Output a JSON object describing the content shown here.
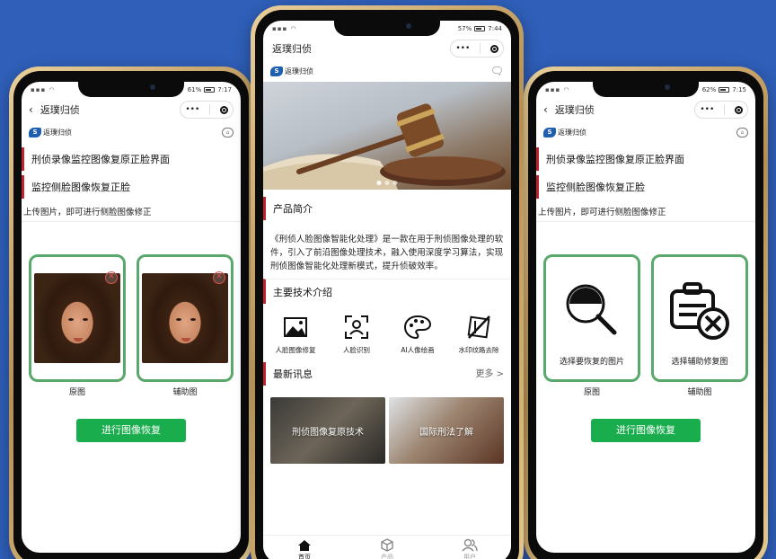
{
  "left_phone": {
    "status": {
      "time": "7:17",
      "battery": "61%"
    },
    "nav_title": "返璞归侦",
    "brand": "返璞归侦",
    "heading1": "刑侦录像监控图像复原正脸界面",
    "heading2": "监控侧脸图像恢复正脸",
    "subtitle": "上传图片，即可进行侧脸图像修正",
    "tile1_label": "原图",
    "tile2_label": "辅助图",
    "button": "进行图像恢复"
  },
  "center_phone": {
    "status": {
      "time": "7:44",
      "battery": "57%"
    },
    "nav_title": "返璞归侦",
    "brand": "返璞归侦",
    "section_intro": "产品简介",
    "intro_text": "《刑侦人脸图像智能化处理》是一款在用于刑侦图像处理的软件，引入了前沿图像处理技术，融入使用深度学习算法，实现刑侦图像智能化处理新模式，提升侦破效率。",
    "section_tech": "主要技术介绍",
    "tech_items": [
      "人脸图像修复",
      "人脸识别",
      "AI人像绘画",
      "水印纹路去除"
    ],
    "section_news": "最新讯息",
    "more": "更多 >",
    "news": [
      "刑侦图像复原技术",
      "国际刑法了解"
    ],
    "tabs": [
      "首页",
      "产品",
      "用户"
    ]
  },
  "right_phone": {
    "status": {
      "time": "7:15",
      "battery": "62%"
    },
    "nav_title": "返璞归侦",
    "brand": "返璞归侦",
    "heading1": "刑侦录像监控图像复原正脸界面",
    "heading2": "监控侧脸图像恢复正脸",
    "subtitle": "上传图片，即可进行侧脸图像修正",
    "tile1_caption": "选择要恢复的图片",
    "tile2_caption": "选择辅助修复图",
    "tile1_label": "原图",
    "tile2_label": "辅助图",
    "button": "进行图像恢复"
  },
  "colors": {
    "background": "#2f5fb9",
    "accent_green": "#1aad4e",
    "tile_border": "#5aa96c",
    "heading_bar": "#c0232d"
  }
}
